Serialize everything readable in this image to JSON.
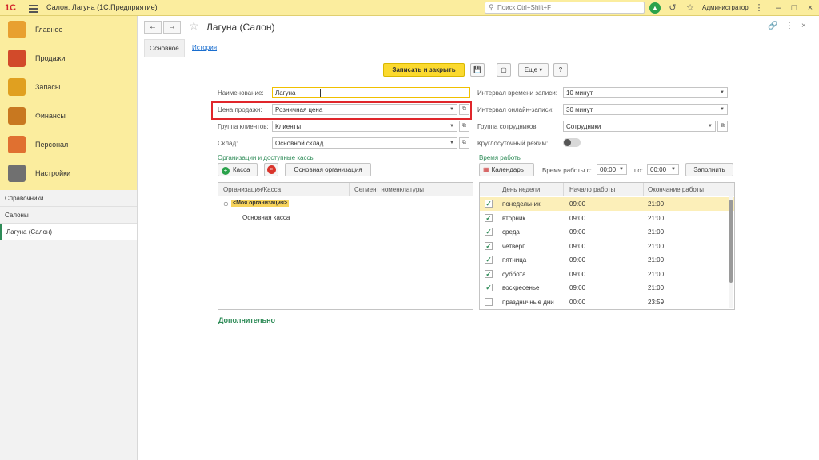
{
  "app": {
    "logo": "1С",
    "title": "Салон: Лагуна (1С:Предприятие)",
    "search_placeholder": "Поиск Ctrl+Shift+F",
    "user": "Администратор"
  },
  "sections": [
    {
      "label": "Главное",
      "color": "#e8a030"
    },
    {
      "label": "Продажи",
      "color": "#d24a2a"
    },
    {
      "label": "Запасы",
      "color": "#e0a020"
    },
    {
      "label": "Финансы",
      "color": "#c87820"
    },
    {
      "label": "Персонал",
      "color": "#e07030"
    },
    {
      "label": "Настройки",
      "color": "#707070"
    }
  ],
  "nav": [
    {
      "label": "Справочники"
    },
    {
      "label": "Салоны"
    },
    {
      "label": "Лагуна (Салон)"
    }
  ],
  "form": {
    "title": "Лагуна (Салон)",
    "tabs": {
      "main": "Основное",
      "history": "История"
    },
    "commands": {
      "save_close": "Записать и закрыть",
      "more": "Еще",
      "help": "?"
    },
    "left": {
      "name_label": "Наименование:",
      "name_value": "Лагуна",
      "price_label": "Цена продажи:",
      "price_value": "Розничная цена",
      "group_label": "Группа клиентов:",
      "group_value": "Клиенты",
      "warehouse_label": "Склад:",
      "warehouse_value": "Основной склад"
    },
    "right": {
      "interval_label": "Интервал времени записи:",
      "interval_value": "10 минут",
      "online_label": "Интервал онлайн-записи:",
      "online_value": "30 минут",
      "staff_label": "Группа сотрудников:",
      "staff_value": "Сотрудники",
      "allday_label": "Круглосуточный режим:"
    },
    "orgs": {
      "title": "Организации и доступные кассы",
      "add_label": "Касса",
      "main_org_label": "Основная организация",
      "columns": [
        "Организация/Касса",
        "Сегмент номенклатуры"
      ],
      "rows": [
        {
          "name": "<Моя организация>",
          "segment": ""
        },
        {
          "name": "Основная касса",
          "segment": ""
        }
      ]
    },
    "work": {
      "title": "Время работы",
      "calendar_label": "Календарь",
      "from_label": "Время работы с:",
      "from_value": "00:00",
      "to_label": "по:",
      "to_value": "00:00",
      "fill_label": "Заполнить",
      "columns": [
        "День недели",
        "Начало работы",
        "Окончание работы"
      ],
      "rows": [
        {
          "day": "понедельник",
          "start": "09:00",
          "end": "21:00",
          "checked": true
        },
        {
          "day": "вторник",
          "start": "09:00",
          "end": "21:00",
          "checked": true
        },
        {
          "day": "среда",
          "start": "09:00",
          "end": "21:00",
          "checked": true
        },
        {
          "day": "четверг",
          "start": "09:00",
          "end": "21:00",
          "checked": true
        },
        {
          "day": "пятница",
          "start": "09:00",
          "end": "21:00",
          "checked": true
        },
        {
          "day": "суббота",
          "start": "09:00",
          "end": "21:00",
          "checked": true
        },
        {
          "day": "воскресенье",
          "start": "09:00",
          "end": "21:00",
          "checked": true
        },
        {
          "day": "праздничные дни",
          "start": "00:00",
          "end": "23:59",
          "checked": false
        }
      ]
    },
    "extra_label": "Дополнительно"
  }
}
